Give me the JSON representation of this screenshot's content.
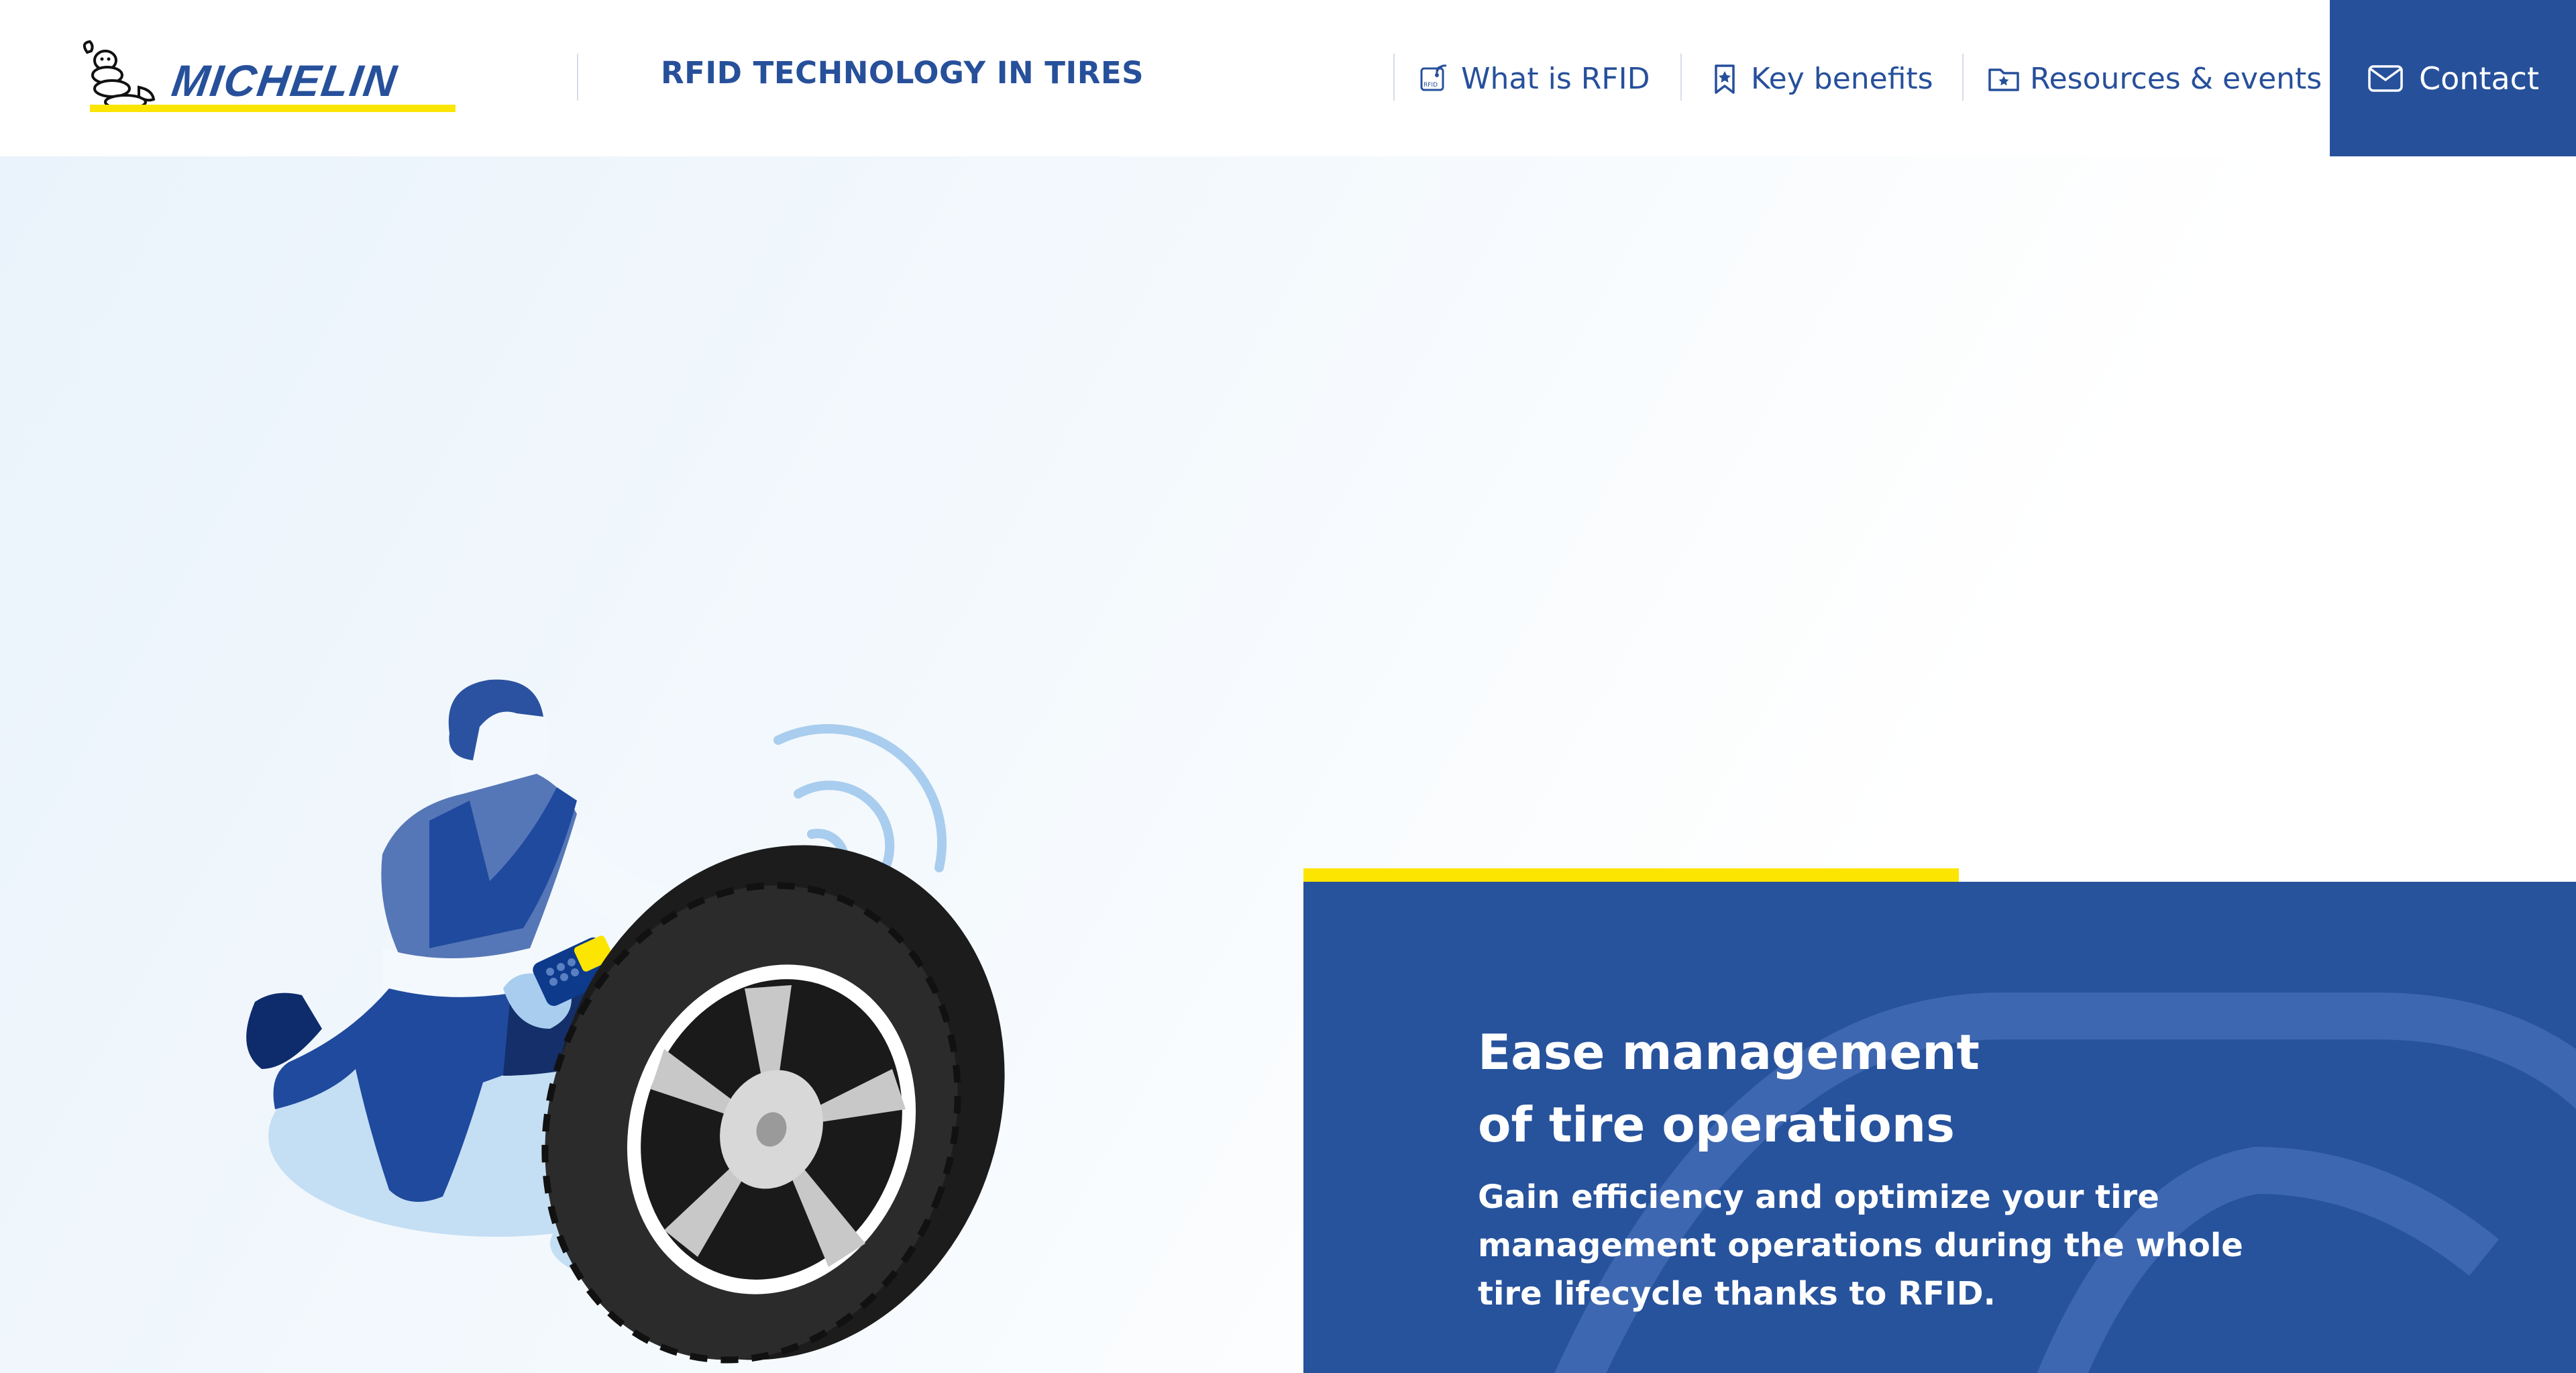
{
  "header": {
    "brand": "MICHELIN",
    "site_title": "RFID TECHNOLOGY IN TIRES",
    "nav": [
      {
        "label": "What is RFID",
        "icon": "rfid-tag-icon"
      },
      {
        "label": "Key benefits",
        "icon": "bookmark-star-icon"
      },
      {
        "label": "Resources & events",
        "icon": "folder-star-icon"
      }
    ],
    "contact": {
      "label": "Contact",
      "icon": "envelope-icon"
    }
  },
  "hero": {
    "illustration": "mechanic-scanning-tire-rfid",
    "card": {
      "title_line1": "Ease management",
      "title_line2": "of tire operations",
      "text": "Gain efficiency and optimize your tire management operations during the whole tire lifecycle thanks to RFID."
    }
  },
  "colors": {
    "brand_blue": "#27509b",
    "accent_yellow": "#fce500",
    "card_blue": "#27529c",
    "hero_bg": "#eef5fb"
  }
}
